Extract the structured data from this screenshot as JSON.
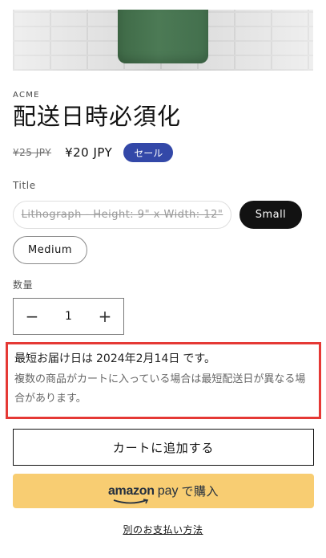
{
  "product": {
    "image_alt": "green t-shirt on white brick wall",
    "vendor": "ACME",
    "title": "配送日時必須化"
  },
  "price": {
    "compare_at": "¥25 JPY",
    "sale": "¥20 JPY",
    "badge": "セール"
  },
  "options": {
    "label": "Title",
    "values": [
      {
        "label": "Lithograph - Height: 9\" x Width: 12\"",
        "state": "disabled"
      },
      {
        "label": "Small",
        "state": "selected"
      },
      {
        "label": "Medium",
        "state": "available"
      }
    ]
  },
  "quantity": {
    "label": "数量",
    "value": "1",
    "minus": "−",
    "plus": "+"
  },
  "delivery_notice": {
    "prefix": "最短お届け日は",
    "date": "2024年2月14日",
    "suffix": "です。",
    "note": "複数の商品がカートに入っている場合は最短配送日が異なる場合があります。",
    "border_color": "#e53935"
  },
  "actions": {
    "add_to_cart": "カートに追加する",
    "amazon_pay_word": "amazon",
    "amazon_pay_suffix": "pay",
    "amazon_pay_label": "で購入",
    "more_payment_options": "別のお支払い方法"
  },
  "colors": {
    "sale_badge": "#3348a8",
    "amazon_button": "#f8cd72",
    "selected_pill": "#121212"
  }
}
